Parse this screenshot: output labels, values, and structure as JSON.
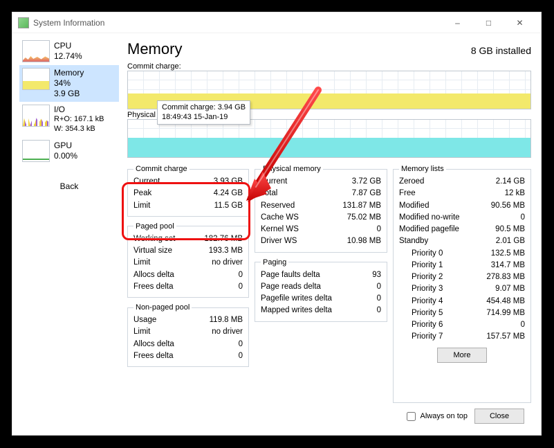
{
  "window": {
    "title": "System Information"
  },
  "sidebar": {
    "items": [
      {
        "name": "CPU",
        "sub1": "12.74%",
        "sub2": ""
      },
      {
        "name": "Memory",
        "sub1": "34%",
        "sub2": "3.9 GB"
      },
      {
        "name": "I/O",
        "sub1": "R+O: 167.1 kB",
        "sub2": "W: 354.3 kB"
      },
      {
        "name": "GPU",
        "sub1": "0.00%",
        "sub2": ""
      }
    ],
    "back": "Back"
  },
  "header": {
    "title": "Memory",
    "installed": "8 GB installed"
  },
  "charts": {
    "commit_label": "Commit charge:",
    "physical_label": "Physical memory:",
    "tooltip_line1": "Commit charge: 3.94 GB",
    "tooltip_line2": "18:49:43 15-Jan-19"
  },
  "commit_charge": {
    "legend": "Commit charge",
    "current_k": "Current",
    "current_v": "3.93 GB",
    "peak_k": "Peak",
    "peak_v": "4.24 GB",
    "limit_k": "Limit",
    "limit_v": "11.5 GB"
  },
  "paged_pool": {
    "legend": "Paged pool",
    "working_k": "Working set",
    "working_v": "182.76 MB",
    "virtual_k": "Virtual size",
    "virtual_v": "193.3 MB",
    "limit_k": "Limit",
    "limit_v": "no driver",
    "allocs_k": "Allocs delta",
    "allocs_v": "0",
    "frees_k": "Frees delta",
    "frees_v": "0"
  },
  "nonpaged_pool": {
    "legend": "Non-paged pool",
    "usage_k": "Usage",
    "usage_v": "119.8 MB",
    "limit_k": "Limit",
    "limit_v": "no driver",
    "allocs_k": "Allocs delta",
    "allocs_v": "0",
    "frees_k": "Frees delta",
    "frees_v": "0"
  },
  "physical_memory": {
    "legend": "Physical memory",
    "current_k": "Current",
    "current_v": "3.72 GB",
    "total_k": "Total",
    "total_v": "7.87 GB",
    "reserved_k": "Reserved",
    "reserved_v": "131.87 MB",
    "cache_k": "Cache WS",
    "cache_v": "75.02 MB",
    "kernel_k": "Kernel WS",
    "kernel_v": "0",
    "driver_k": "Driver WS",
    "driver_v": "10.98 MB"
  },
  "paging": {
    "legend": "Paging",
    "faults_k": "Page faults delta",
    "faults_v": "93",
    "reads_k": "Page reads delta",
    "reads_v": "0",
    "pfw_k": "Pagefile writes delta",
    "pfw_v": "0",
    "mw_k": "Mapped writes delta",
    "mw_v": "0"
  },
  "memory_lists": {
    "legend": "Memory lists",
    "zeroed_k": "Zeroed",
    "zeroed_v": "2.14 GB",
    "free_k": "Free",
    "free_v": "12 kB",
    "modified_k": "Modified",
    "modified_v": "90.56 MB",
    "mod_nw_k": "Modified no-write",
    "mod_nw_v": "0",
    "mod_pf_k": "Modified pagefile",
    "mod_pf_v": "90.5 MB",
    "standby_k": "Standby",
    "standby_v": "2.01 GB",
    "p0_k": "Priority 0",
    "p0_v": "132.5 MB",
    "p1_k": "Priority 1",
    "p1_v": "314.7 MB",
    "p2_k": "Priority 2",
    "p2_v": "278.83 MB",
    "p3_k": "Priority 3",
    "p3_v": "9.07 MB",
    "p4_k": "Priority 4",
    "p4_v": "454.48 MB",
    "p5_k": "Priority 5",
    "p5_v": "714.99 MB",
    "p6_k": "Priority 6",
    "p6_v": "0",
    "p7_k": "Priority 7",
    "p7_v": "157.57 MB",
    "more": "More"
  },
  "footer": {
    "always": "Always on top",
    "close": "Close"
  }
}
